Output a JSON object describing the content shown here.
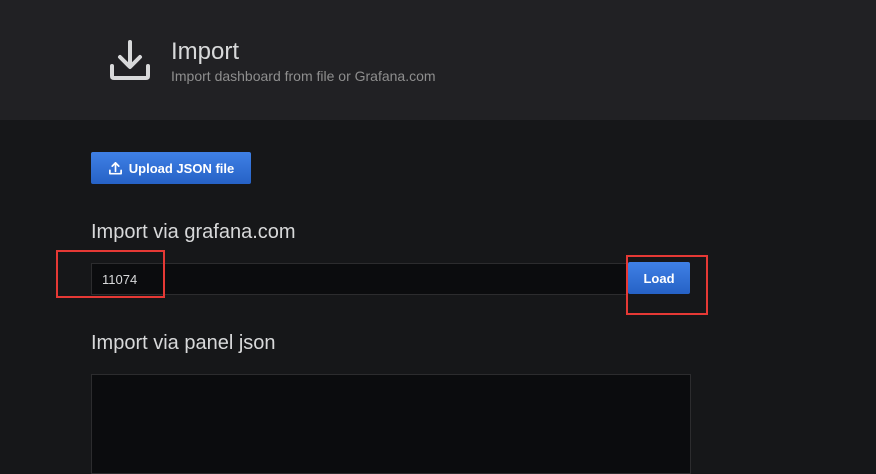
{
  "header": {
    "title": "Import",
    "subtitle": "Import dashboard from file or Grafana.com",
    "icon": "download-icon"
  },
  "upload": {
    "label": "Upload JSON file",
    "icon": "upload-icon"
  },
  "grafana_import": {
    "heading": "Import via grafana.com",
    "input_value": "11074",
    "load_label": "Load"
  },
  "panel_json": {
    "heading": "Import via panel json",
    "value": ""
  },
  "colors": {
    "accent": "#3274d9",
    "highlight": "#e53935",
    "header_bg": "#212124",
    "page_bg": "#161719"
  }
}
